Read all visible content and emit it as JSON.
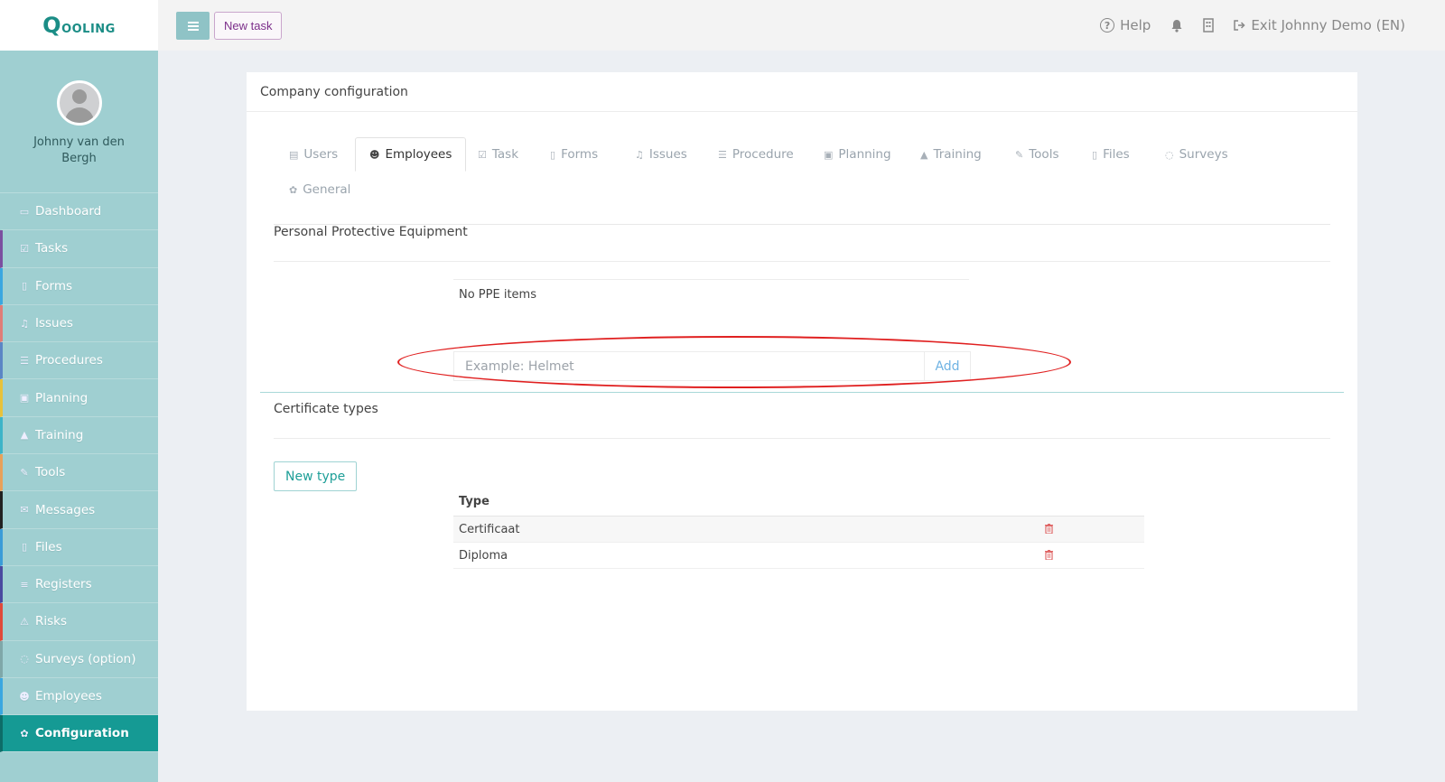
{
  "app": {
    "logo_initial": "Q",
    "logo_rest": "ooling",
    "brand_color": "#1b8d86",
    "accent_color": "#159a94"
  },
  "topbar": {
    "new_task_label": "New task",
    "help_label": "Help",
    "exit_label": "Exit Johnny Demo (EN)"
  },
  "sidebar": {
    "user_name": "Johnny van den Bergh",
    "items": [
      {
        "label": "Dashboard",
        "icon": "monitor-icon",
        "color": "#9fcfd1"
      },
      {
        "label": "Tasks",
        "icon": "check-square-icon",
        "color": "#7b4fa0"
      },
      {
        "label": "Forms",
        "icon": "file-icon",
        "color": "#3aa7e0"
      },
      {
        "label": "Issues",
        "icon": "bell-icon",
        "color": "#e07d78"
      },
      {
        "label": "Procedures",
        "icon": "list-icon",
        "color": "#5b86c5"
      },
      {
        "label": "Planning",
        "icon": "calendar-icon",
        "color": "#e8c23a"
      },
      {
        "label": "Training",
        "icon": "graduation-cap-icon",
        "color": "#3cb4c8"
      },
      {
        "label": "Tools",
        "icon": "wrench-icon",
        "color": "#e8a15a"
      },
      {
        "label": "Messages",
        "icon": "envelope-icon",
        "color": "#222222"
      },
      {
        "label": "Files",
        "icon": "pdf-file-icon",
        "color": "#3a9cd8"
      },
      {
        "label": "Registers",
        "icon": "bars-icon",
        "color": "#4a4aa0"
      },
      {
        "label": "Risks",
        "icon": "warning-icon",
        "color": "#e04a3a"
      },
      {
        "label": "Surveys (option)",
        "icon": "comment-icon",
        "color": "#7fa7a8"
      },
      {
        "label": "Employees",
        "icon": "users-icon",
        "color": "#3aa7e0"
      },
      {
        "label": "Configuration",
        "icon": "gear-icon",
        "color": "#0d6d68"
      }
    ]
  },
  "panel": {
    "title": "Company configuration",
    "tabs": [
      {
        "label": "Users",
        "icon": "id-card-icon"
      },
      {
        "label": "Employees",
        "icon": "users-icon"
      },
      {
        "label": "Task",
        "icon": "check-square-icon"
      },
      {
        "label": "Forms",
        "icon": "file-icon"
      },
      {
        "label": "Issues",
        "icon": "bell-icon"
      },
      {
        "label": "Procedure",
        "icon": "list-icon"
      },
      {
        "label": "Planning",
        "icon": "calendar-icon"
      },
      {
        "label": "Training",
        "icon": "graduation-cap-icon"
      },
      {
        "label": "Tools",
        "icon": "wrench-icon"
      },
      {
        "label": "Files",
        "icon": "file-icon"
      },
      {
        "label": "Surveys",
        "icon": "comment-icon"
      },
      {
        "label": "General",
        "icon": "gear-icon"
      }
    ],
    "active_tab": "Employees",
    "ppe": {
      "title": "Personal Protective Equipment",
      "empty_text": "No PPE items",
      "input_placeholder": "Example: Helmet",
      "add_label": "Add"
    },
    "certificates": {
      "title": "Certificate types",
      "new_type_label": "New type",
      "column_type": "Type",
      "rows": [
        "Certificaat",
        "Diploma"
      ]
    }
  }
}
